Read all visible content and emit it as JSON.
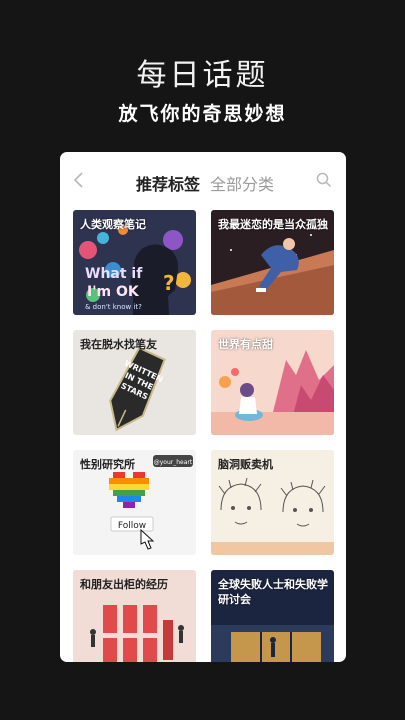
{
  "header": {
    "title": "每日话题",
    "subtitle": "放飞你的奇思妙想"
  },
  "nav": {
    "tabs": [
      {
        "label": "推荐标签",
        "active": true
      },
      {
        "label": "全部分类",
        "active": false
      }
    ],
    "back_icon": "chevron-left-icon",
    "search_icon": "search-icon"
  },
  "topics": [
    {
      "label": "人类观察笔记"
    },
    {
      "label": "我最迷恋的是当众孤独"
    },
    {
      "label": "我在脱水找笔友"
    },
    {
      "label": "世界有点甜"
    },
    {
      "label": "性别研究所"
    },
    {
      "label": "脑洞贩卖机"
    },
    {
      "label": "和朋友出柜的经历"
    },
    {
      "label": "全球失败人士和失败学研讨会"
    }
  ],
  "artwork_text": {
    "head_words": [
      "What if",
      "I'm OK",
      "& don't know it?",
      "?"
    ],
    "pen_words": [
      "WRITTEN",
      "IN THE",
      "STARS"
    ],
    "handle": "@your_heart",
    "follow_button": "Follow"
  }
}
